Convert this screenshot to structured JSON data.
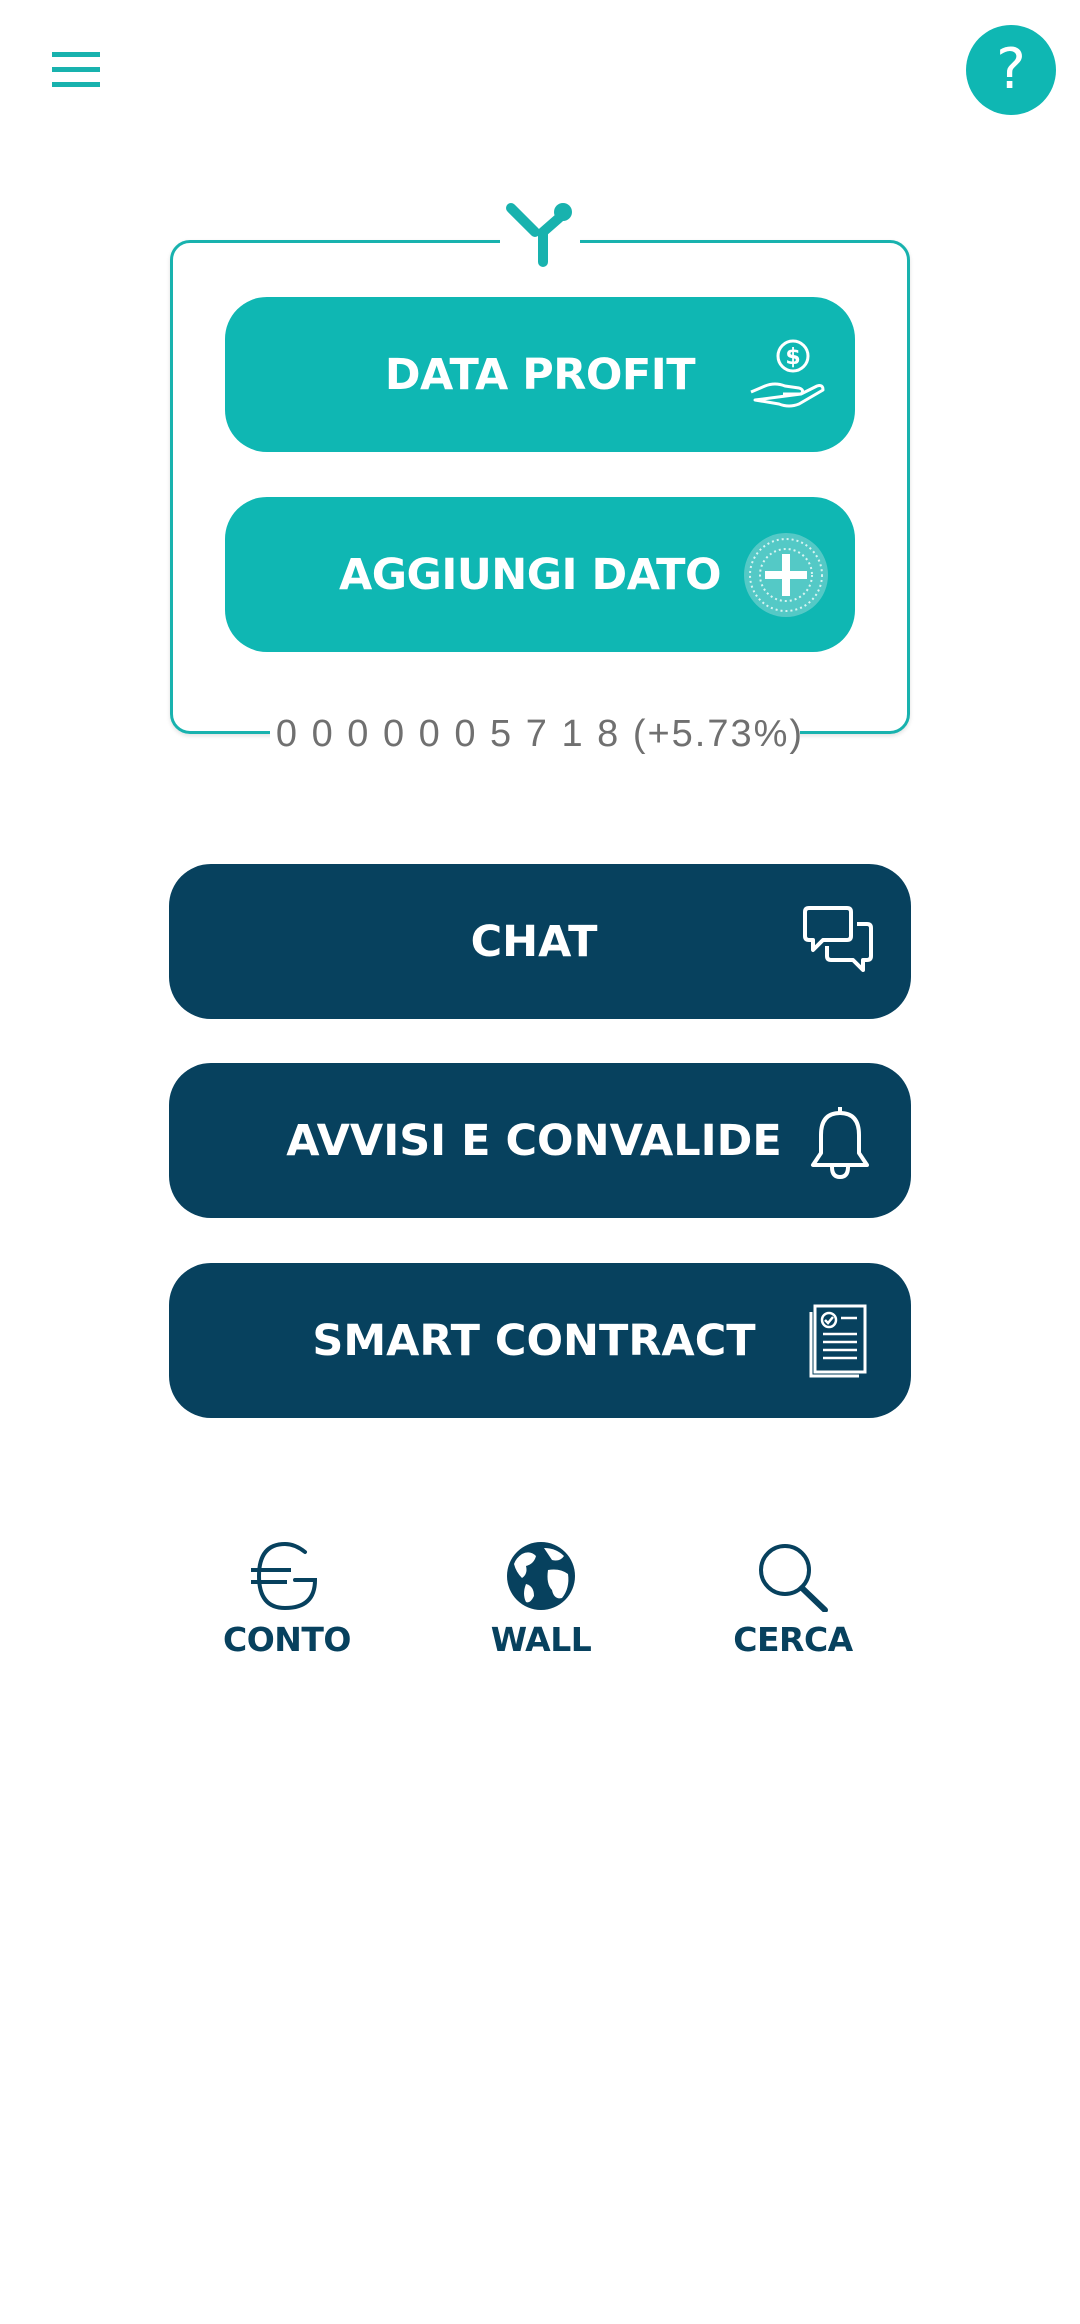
{
  "header": {
    "menu_icon": "hamburger-menu-icon",
    "help_label": "?",
    "help_icon": "question-mark-icon"
  },
  "card": {
    "logo_icon": "brand-y-logo-icon",
    "data_profit": {
      "label": "DATA PROFIT",
      "icon": "hand-holding-coin-icon"
    },
    "aggiungi_dato": {
      "label": "AGGIUNGI DATO",
      "icon": "plus-globe-icon"
    },
    "counter": "0 0 0 0 0 0 5 7 1 8 (+5.73%)"
  },
  "actions": {
    "chat": {
      "label": "CHAT",
      "icon": "chat-bubbles-icon"
    },
    "avvisi": {
      "label": "AVVISI E CONVALIDE",
      "icon": "bell-icon"
    },
    "smart_contract": {
      "label": "SMART CONTRACT",
      "icon": "contract-document-icon"
    }
  },
  "bottom_nav": {
    "conto": {
      "label": "CONTO",
      "icon": "euro-icon"
    },
    "wall": {
      "label": "WALL",
      "icon": "globe-icon"
    },
    "cerca": {
      "label": "CERCA",
      "icon": "search-icon"
    }
  },
  "colors": {
    "teal": "#0fb7b3",
    "navy": "#07415e",
    "counter_text": "#707070"
  }
}
